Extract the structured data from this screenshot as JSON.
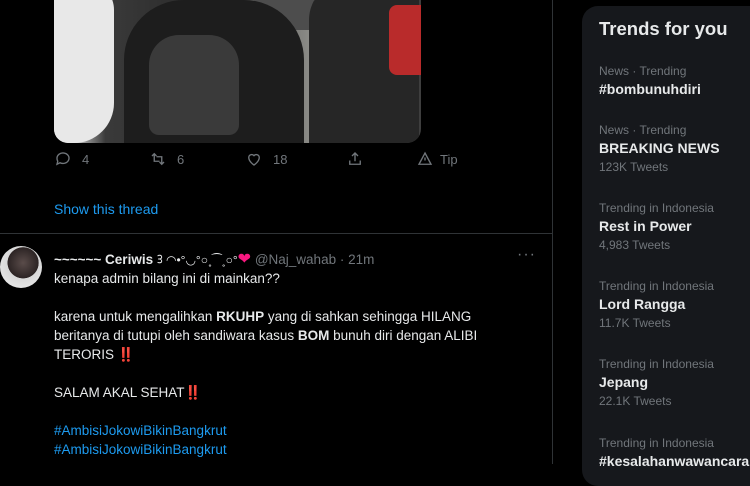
{
  "tweet_prev": {
    "actions": {
      "reply_count": "4",
      "retweet_count": "6",
      "like_count": "18",
      "tip_label": "Tip"
    },
    "show_thread": "Show this thread"
  },
  "tweet": {
    "name": "~~~~~~ Ceriwis",
    "name_deco": "ᢃ ◠•°◡°○˳⁀˳○°",
    "handle": "@Naj_wahab",
    "separator": "·",
    "time": "21m",
    "more": "···",
    "line1": "kenapa admin bilang ini di mainkan??",
    "p2_a": "karena untuk mengalihkan ",
    "p2_b": "RKUHP",
    "p2_c": " yang di sahkan sehingga HILANG beritanya di tutupi oleh sandiwara kasus ",
    "p2_d": "BOM",
    "p2_e": " bunuh diri dengan ALIBI TERORIS ",
    "p2_bang": "‼️",
    "p3": "SALAM AKAL SEHAT",
    "p3_bang": "‼️",
    "hashtags": [
      "#AmbisiJokowiBikinBangkrut",
      "#AmbisiJokowiBikinBangkrut"
    ]
  },
  "sidebar": {
    "title": "Trends for you",
    "trends": [
      {
        "meta": "News · Trending",
        "title": "#bombunuhdiri",
        "count": ""
      },
      {
        "meta": "News · Trending",
        "title": "BREAKING NEWS",
        "count": "123K Tweets"
      },
      {
        "meta": "Trending in Indonesia",
        "title": "Rest in Power",
        "count": "4,983 Tweets"
      },
      {
        "meta": "Trending in Indonesia",
        "title": "Lord Rangga",
        "count": "11.7K Tweets"
      },
      {
        "meta": "Trending in Indonesia",
        "title": "Jepang",
        "count": "22.1K Tweets"
      },
      {
        "meta": "Trending in Indonesia",
        "title": "#kesalahanwawancara",
        "count": ""
      }
    ]
  },
  "icons": [
    "reply-icon",
    "retweet-icon",
    "like-icon",
    "share-icon",
    "tip-icon",
    "more-icon"
  ],
  "colors": {
    "accent": "#1d9bf0",
    "background": "#000000",
    "panel": "#16181c",
    "muted": "#71767b",
    "heart": "#f91880"
  }
}
